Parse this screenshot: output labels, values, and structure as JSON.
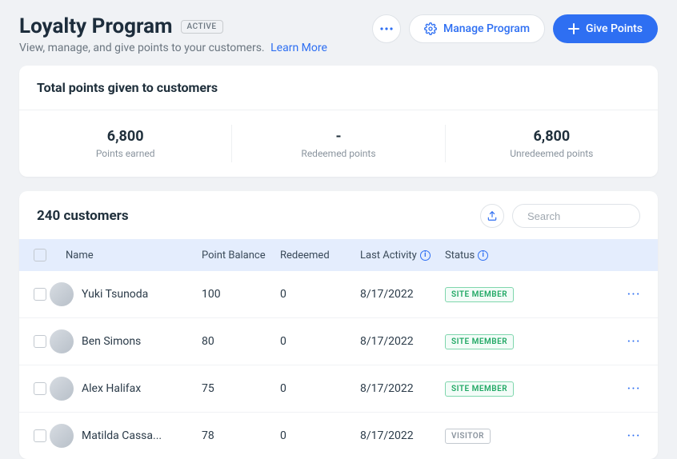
{
  "header": {
    "title": "Loyalty Program",
    "status_chip": "ACTIVE",
    "subtitle": "View, manage, and give points to your customers.",
    "learn_more": "Learn More",
    "more_aria": "More actions",
    "manage_label": "Manage Program",
    "give_label": "Give Points"
  },
  "totals": {
    "card_title": "Total points given to customers",
    "stats": [
      {
        "value": "6,800",
        "label": "Points earned"
      },
      {
        "value": "-",
        "label": "Redeemed points"
      },
      {
        "value": "6,800",
        "label": "Unredeemed points"
      }
    ]
  },
  "customers": {
    "count_label": "240 customers",
    "search_placeholder": "Search",
    "columns": {
      "name": "Name",
      "balance": "Point Balance",
      "redeemed": "Redeemed",
      "last_activity": "Last Activity",
      "status": "Status"
    },
    "rows": [
      {
        "name": "Yuki Tsunoda",
        "balance": "100",
        "redeemed": "0",
        "last": "8/17/2022",
        "status": "SITE MEMBER",
        "status_kind": "member"
      },
      {
        "name": "Ben Simons",
        "balance": "80",
        "redeemed": "0",
        "last": "8/17/2022",
        "status": "SITE MEMBER",
        "status_kind": "member"
      },
      {
        "name": "Alex Halifax",
        "balance": "75",
        "redeemed": "0",
        "last": "8/17/2022",
        "status": "SITE MEMBER",
        "status_kind": "member"
      },
      {
        "name": "Matilda Cassa...",
        "balance": "78",
        "redeemed": "0",
        "last": "8/17/2022",
        "status": "VISITOR",
        "status_kind": "visitor"
      }
    ]
  }
}
